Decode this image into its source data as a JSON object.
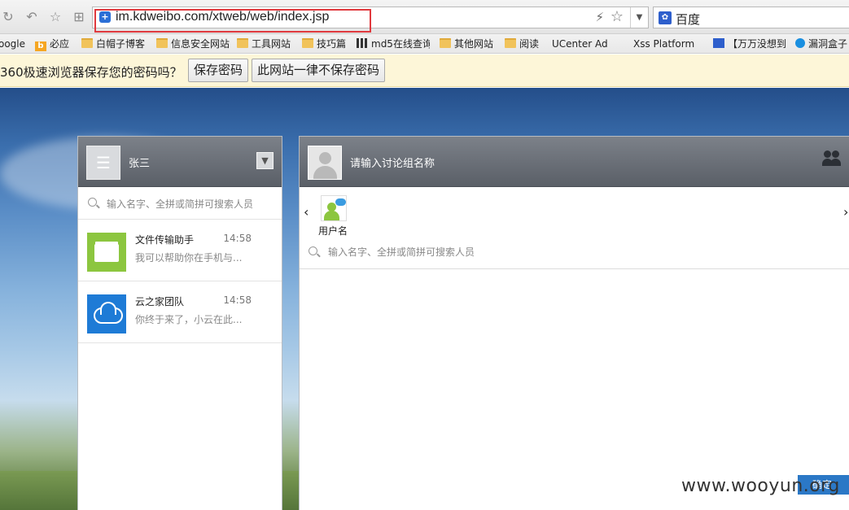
{
  "browser": {
    "url": "im.kdweibo.com/xtweb/web/index.jsp",
    "search_engine": "百度",
    "bookmarks": [
      {
        "label": "oogle",
        "icon": "none"
      },
      {
        "label": "必应",
        "icon": "bing-icon"
      },
      {
        "label": "白帽子博客",
        "icon": "folder-icon"
      },
      {
        "label": "信息安全网站",
        "icon": "folder-icon"
      },
      {
        "label": "工具网站",
        "icon": "folder-icon"
      },
      {
        "label": "技巧篇",
        "icon": "folder-icon"
      },
      {
        "label": "md5在线查询",
        "icon": "grid-icon"
      },
      {
        "label": "其他网站",
        "icon": "folder-icon"
      },
      {
        "label": "阅读",
        "icon": "folder-icon"
      },
      {
        "label": "UCenter Ad",
        "icon": "page-icon"
      },
      {
        "label": "Xss Platform",
        "icon": "page-icon"
      },
      {
        "label": "【万万没想到",
        "icon": "paw-icon"
      },
      {
        "label": "漏洞盒子",
        "icon": "hex-icon"
      }
    ],
    "password_prompt": {
      "message": "360极速浏览器保存您的密码吗？",
      "save_label": "保存密码",
      "never_label": "此网站一律不保存密码"
    }
  },
  "left_panel": {
    "user_name": "张三",
    "search_placeholder": "输入名字、全拼或简拼可搜索人员",
    "conversations": [
      {
        "title": "文件传输助手",
        "time": "14:58",
        "preview": "我可以帮助你在手机与...",
        "icon": "folder-icon",
        "color": "#8cc63f"
      },
      {
        "title": "云之家团队",
        "time": "14:58",
        "preview": "你终于来了，小云在此...",
        "icon": "cloud-icon",
        "color": "#1e7bd6"
      }
    ]
  },
  "right_panel": {
    "group_name_placeholder": "请输入讨论组名称",
    "member_name": "用户名",
    "search_placeholder": "输入名字、全拼或简拼可搜索人员",
    "send_label": "确定"
  },
  "watermark": "www.wooyun.org"
}
